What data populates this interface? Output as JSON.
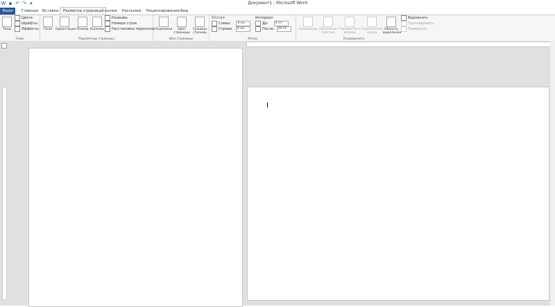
{
  "window": {
    "title": "Документ1 - Microsoft Word"
  },
  "qat": {
    "icons": [
      "word-icon",
      "save-icon",
      "undo-icon",
      "redo-icon",
      "customize-icon"
    ]
  },
  "tabs": [
    "Файл",
    "Главная",
    "Вставка",
    "Разметка страницы",
    "Ссылки",
    "Рассылки",
    "Рецензирование",
    "Вид"
  ],
  "ribbon": {
    "themes": {
      "big": "Темы",
      "colors": "Цвета",
      "fonts": "Шрифты",
      "effects": "Эффекты",
      "label": "Темы"
    },
    "page_setup": {
      "margins": "Поля",
      "orientation": "Ориентация",
      "size": "Размер",
      "columns": "Колонки",
      "breaks": "Разрывы",
      "line_numbers": "Номера строк",
      "hyphenation": "Расстановка переносов",
      "label": "Параметры страницы"
    },
    "page_bg": {
      "watermark": "Подложка",
      "page_color": "Цвет страницы",
      "borders": "Границы страниц",
      "label": "Фон страницы"
    },
    "paragraph": {
      "indent_header": "Отступ",
      "left_label": "Слева:",
      "left_value": "0 см",
      "right_label": "Справа:",
      "right_value": "0 см",
      "spacing_header": "Интервал",
      "before_label": "До:",
      "before_value": "0 пт",
      "after_label": "После:",
      "after_value": "10 пт",
      "label": "Абзац"
    },
    "arrange": {
      "position": "Положение",
      "wrap": "Обтекание текстом",
      "bring_forward": "Переместить вперед",
      "send_backward": "Переместить назад",
      "selection_pane": "Область выделения",
      "align": "Выровнять",
      "group": "Группировать",
      "rotate": "Повернуть",
      "label": "Упорядочить"
    }
  }
}
